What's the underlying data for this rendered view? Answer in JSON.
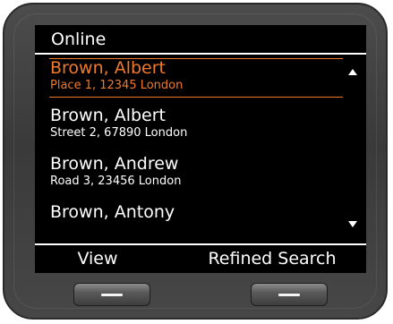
{
  "screen": {
    "title": "Online"
  },
  "entries": [
    {
      "name": "Brown, Albert",
      "address": "Place 1, 12345 London",
      "selected": true
    },
    {
      "name": "Brown, Albert",
      "address": "Street 2, 67890 London",
      "selected": false
    },
    {
      "name": "Brown, Andrew",
      "address": "Road 3, 23456 London",
      "selected": false
    },
    {
      "name": "Brown, Antony",
      "address": "",
      "selected": false
    }
  ],
  "softkeys": {
    "left_label": "View",
    "right_label": "Refined Search"
  },
  "icons": {
    "scroll_up": "triangle-up-icon",
    "scroll_down": "triangle-down-icon",
    "hw_button": "dash-icon"
  },
  "colors": {
    "selection": "#f07a2c",
    "screen_bg": "#000000",
    "text": "#ffffff",
    "device_body": "#404040"
  }
}
